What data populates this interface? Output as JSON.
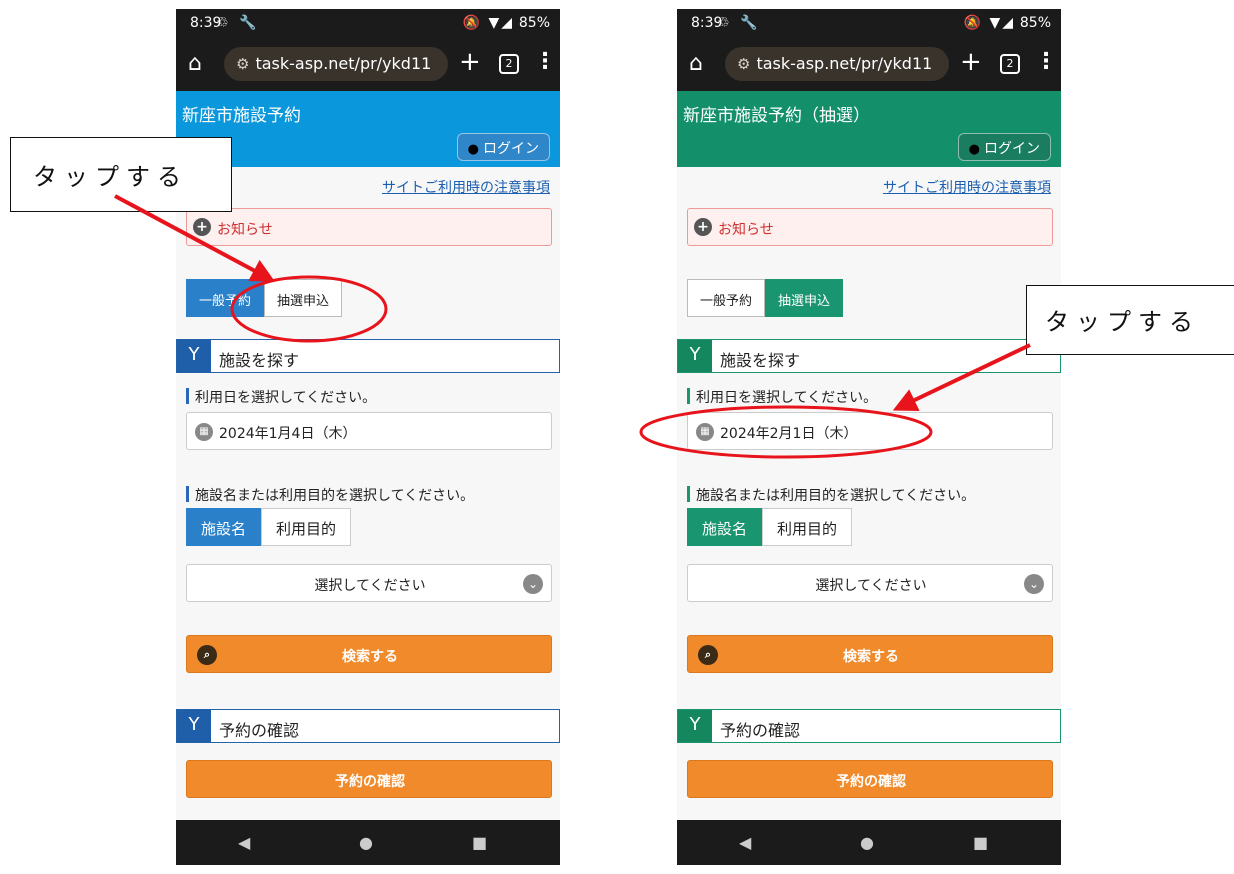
{
  "annotation": {
    "left_callout": "タップする",
    "right_callout": "タップする"
  },
  "colors": {
    "arrow": "#e8141b",
    "left_header": "#0b97db",
    "right_header": "#13906a",
    "orange_button": "#f08a2a"
  },
  "left": {
    "status": {
      "time": "8:39",
      "icons": "♲ 🔧",
      "right_icons": "🔕 ▼◢",
      "battery": "85%"
    },
    "browser": {
      "url": "task-asp.net/pr/ykd11",
      "tab_count": "2"
    },
    "site_title": "新座市施設予約",
    "login_label": "ログイン",
    "notice_link": "サイトご利用時の注意事項",
    "oshirase": "お知らせ",
    "mode_tabs": [
      "一般予約",
      "抽選申込"
    ],
    "section_search": "施設を探す",
    "date_label": "利用日を選択してください。",
    "date_value": "2024年1月4日（木）",
    "facility_label": "施設名または利用目的を選択してください。",
    "facility_tabs": [
      "施設名",
      "利用目的"
    ],
    "select_placeholder": "選択してください",
    "search_button": "検索する",
    "section_confirm": "予約の確認",
    "confirm_button": "予約の確認"
  },
  "right": {
    "status": {
      "time": "8:39",
      "icons": "♲ 🔧",
      "right_icons": "🔕 ▼◢",
      "battery": "85%"
    },
    "browser": {
      "url": "task-asp.net/pr/ykd11",
      "tab_count": "2"
    },
    "site_title": "新座市施設予約（抽選）",
    "login_label": "ログイン",
    "notice_link": "サイトご利用時の注意事項",
    "oshirase": "お知らせ",
    "mode_tabs": [
      "一般予約",
      "抽選申込"
    ],
    "section_search": "施設を探す",
    "date_label": "利用日を選択してください。",
    "date_value": "2024年2月1日（木）",
    "facility_label": "施設名または利用目的を選択してください。",
    "facility_tabs": [
      "施設名",
      "利用目的"
    ],
    "select_placeholder": "選択してください",
    "search_button": "検索する",
    "section_confirm": "予約の確認",
    "confirm_button": "予約の確認"
  }
}
